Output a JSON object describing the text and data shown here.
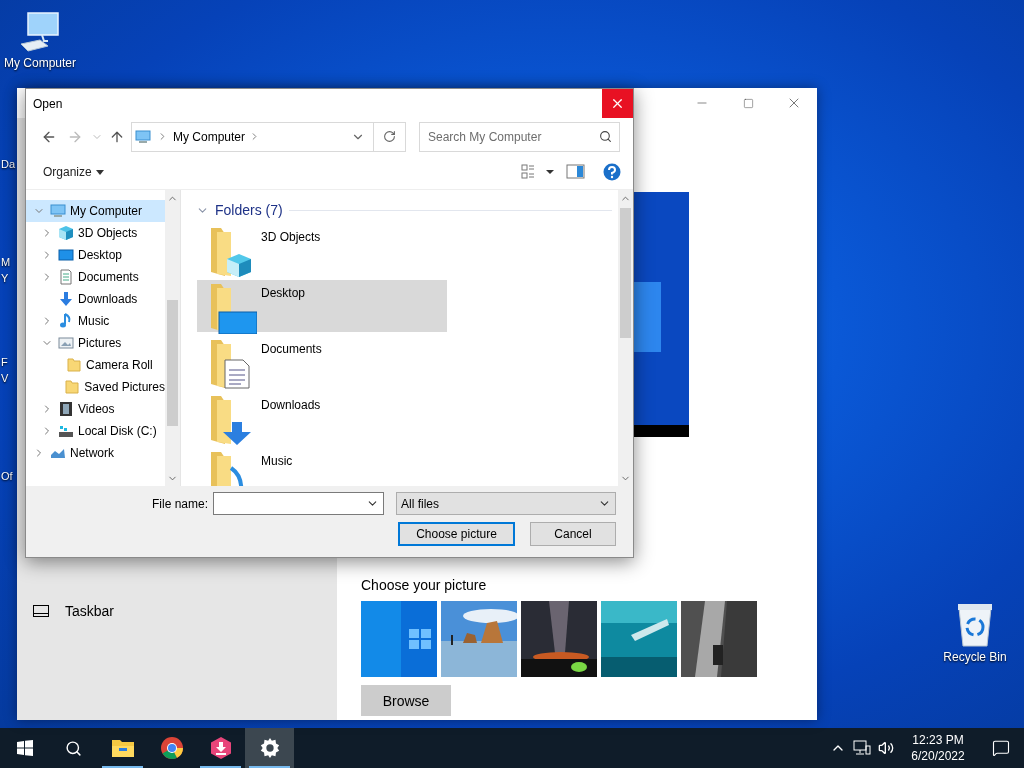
{
  "desktop": {
    "icons": [
      {
        "kind": "computer",
        "label": "My Computer"
      },
      {
        "kind": "recycle_bin",
        "label": "Recycle Bin"
      }
    ],
    "edge_labels": [
      "Da",
      "M",
      "Y",
      "F",
      "V",
      "Of"
    ]
  },
  "settings_window": {
    "sidebar": {
      "items": [
        {
          "kind": "taskbar",
          "label": "Taskbar"
        }
      ]
    },
    "choose_label": "Choose your picture",
    "browse_button": "Browse"
  },
  "open_dialog": {
    "title": "Open",
    "address": {
      "location": "My Computer"
    },
    "search": {
      "placeholder": "Search My Computer"
    },
    "organize": "Organize",
    "nav_tree": [
      {
        "kind": "computer",
        "label": "My Computer",
        "selected": true,
        "expanded": true,
        "children": [
          {
            "kind": "cube",
            "label": "3D Objects",
            "selected": false,
            "expanded": false
          },
          {
            "kind": "desktop",
            "label": "Desktop",
            "selected": false,
            "expanded": false
          },
          {
            "kind": "documents",
            "label": "Documents",
            "selected": false,
            "expanded": false
          },
          {
            "kind": "downloads",
            "label": "Downloads",
            "selected": false
          },
          {
            "kind": "music",
            "label": "Music",
            "selected": false,
            "expanded": false
          },
          {
            "kind": "pictures",
            "label": "Pictures",
            "selected": false,
            "expanded": true,
            "children": [
              {
                "kind": "folder",
                "label": "Camera Roll",
                "selected": false
              },
              {
                "kind": "folder",
                "label": "Saved Pictures",
                "selected": false
              }
            ]
          },
          {
            "kind": "videos",
            "label": "Videos",
            "selected": false,
            "expanded": false
          },
          {
            "kind": "disk",
            "label": "Local Disk (C:)",
            "selected": false,
            "expanded": false
          }
        ]
      },
      {
        "kind": "network",
        "label": "Network",
        "selected": false,
        "expanded": false
      }
    ],
    "folders_header": "Folders (7)",
    "folders": [
      {
        "kind": "cube",
        "label": "3D Objects",
        "selected": false
      },
      {
        "kind": "desktop",
        "label": "Desktop",
        "selected": true
      },
      {
        "kind": "documents",
        "label": "Documents",
        "selected": false
      },
      {
        "kind": "downloads",
        "label": "Downloads",
        "selected": false
      },
      {
        "kind": "music",
        "label": "Music",
        "selected": false
      }
    ],
    "file_name": {
      "label": "File name:"
    },
    "file_type": "All files",
    "buttons": [
      {
        "label": "Choose picture",
        "default": true
      },
      {
        "label": "Cancel",
        "default": false
      }
    ]
  },
  "taskbar": {
    "apps": [
      {
        "kind": "explorer",
        "running": true,
        "active": false
      },
      {
        "kind": "chrome",
        "running": false,
        "active": false
      },
      {
        "kind": "installer",
        "running": true,
        "active": false
      },
      {
        "kind": "settings",
        "running": true,
        "active": true
      }
    ],
    "time": "12:23 PM",
    "date": "6/20/2022"
  }
}
